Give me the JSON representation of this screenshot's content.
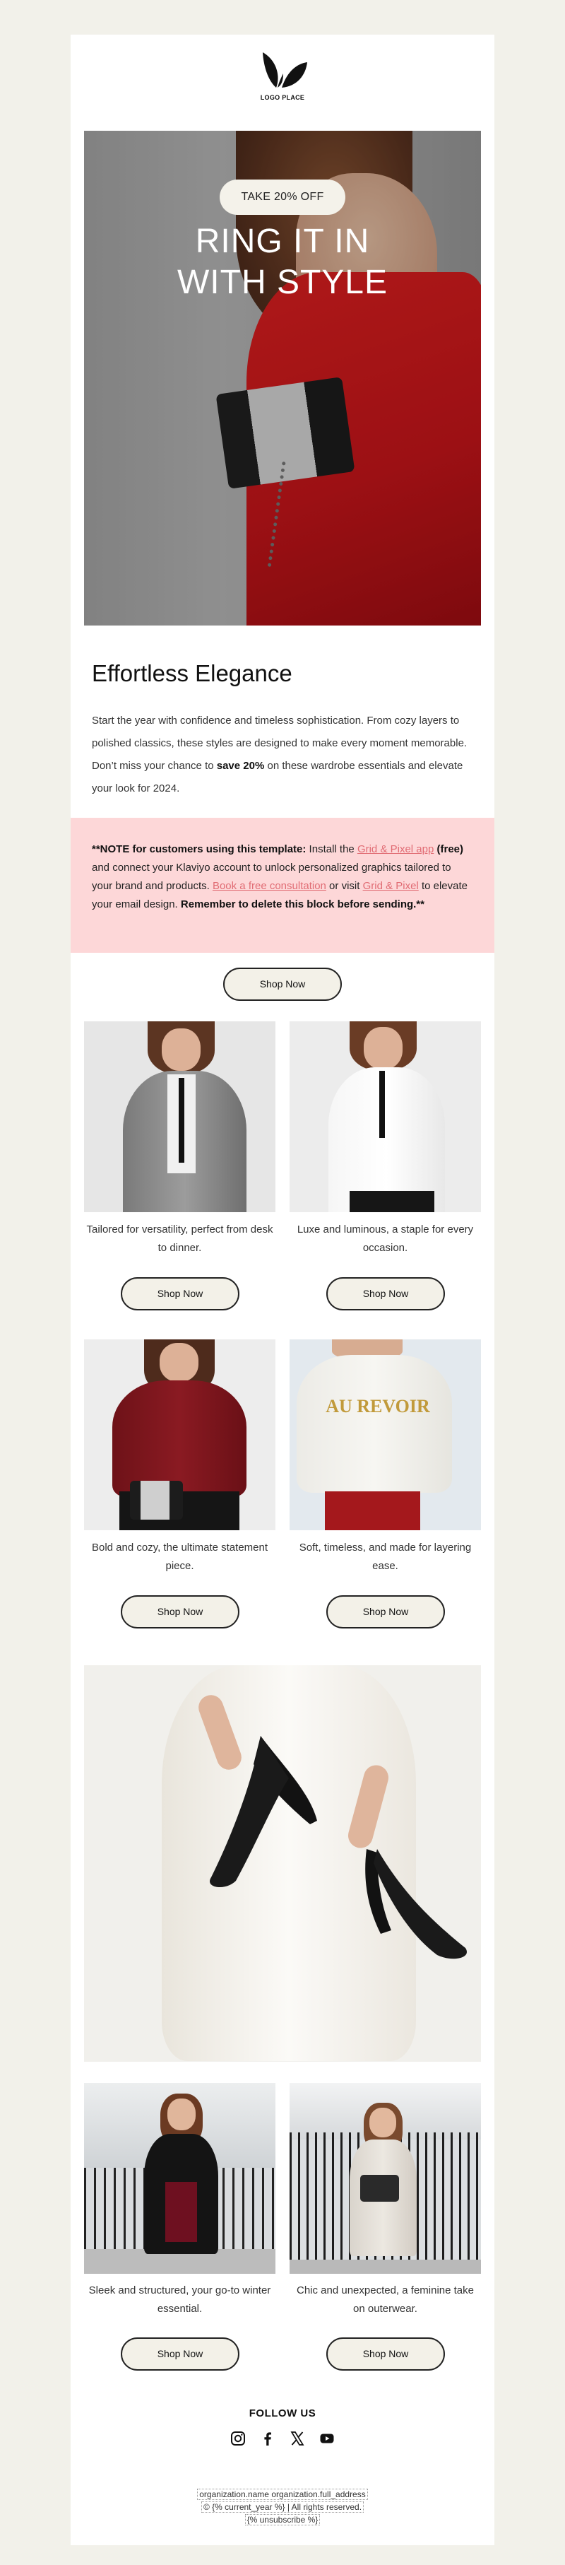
{
  "logo": {
    "text": "LOGO PLACE"
  },
  "hero": {
    "pill": "TAKE 20% OFF",
    "title_line1": "RING IT IN",
    "title_line2": "WITH STYLE"
  },
  "section": {
    "heading": "Effortless Elegance",
    "intro_part1": "Start the year with confidence and timeless sophistication. From cozy layers to polished classics, these styles are designed to make every moment memorable. Don’t miss your chance to ",
    "intro_bold": "save 20%",
    "intro_part2": " on these wardrobe essentials and elevate your look for 2024."
  },
  "note": {
    "bold1": "**NOTE for customers using this template:",
    "text1": " Install the ",
    "link1": "Grid & Pixel app",
    "bold2": " (free)",
    "text2": " and connect your Klaviyo account to unlock personalized graphics tailored to your brand and products. ",
    "link2": "Book a free consultation",
    "text3": " or visit ",
    "link3": "Grid & Pixel",
    "text4": " to elevate your email design. ",
    "bold3": "Remember to delete this block before sending.**"
  },
  "main_button": "Shop Now",
  "products": [
    {
      "caption": "Tailored for versatility, perfect from desk to dinner.",
      "button": "Shop Now"
    },
    {
      "caption": "Luxe and luminous, a staple for every occasion.",
      "button": "Shop Now"
    },
    {
      "caption": "Bold and cozy, the ultimate statement piece.",
      "button": "Shop Now"
    },
    {
      "caption": "Soft, timeless, and made for layering ease.",
      "button": "Shop Now"
    },
    {
      "caption": "Sleek and structured, your go-to winter essential.",
      "button": "Shop Now"
    },
    {
      "caption": "Chic and unexpected, a feminine take on outerwear.",
      "button": "Shop Now"
    }
  ],
  "sweater_print": "AU REVOIR",
  "footer": {
    "follow": "FOLLOW US",
    "social": [
      "instagram-icon",
      "facebook-icon",
      "x-icon",
      "youtube-icon"
    ],
    "line1": "organization.name organization.full_address",
    "line2": "© {% current_year %} | All rights reserved.",
    "line3": "{% unsubscribe %}"
  },
  "colors": {
    "background": "#f2f1ea",
    "note_bg": "#fdd7d8",
    "link": "#e16c74",
    "button_bg": "#f3f1e8",
    "dress_red": "#c8151a"
  }
}
